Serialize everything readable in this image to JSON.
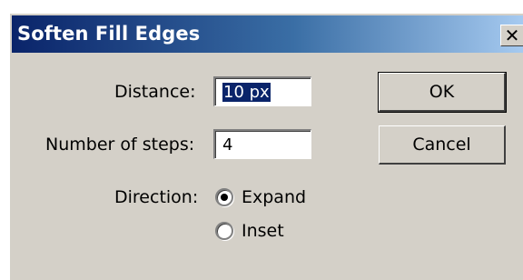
{
  "dialog": {
    "title": "Soften Fill Edges",
    "close_glyph": "✕",
    "distance_label": "Distance:",
    "distance_value": "10 px",
    "steps_label": "Number of steps:",
    "steps_value": "4",
    "direction_label": "Direction:",
    "options": [
      {
        "label": "Expand",
        "selected": true
      },
      {
        "label": "Inset",
        "selected": false
      }
    ],
    "ok_label": "OK",
    "cancel_label": "Cancel"
  },
  "colors": {
    "titlebar_start": "#0a246a",
    "titlebar_end": "#a6caf0",
    "face": "#d4d0c8",
    "selection": "#0a246a"
  },
  "icons": {
    "close": "close-icon",
    "radio_selected": "radio-selected-icon",
    "radio_unselected": "radio-unselected-icon"
  }
}
